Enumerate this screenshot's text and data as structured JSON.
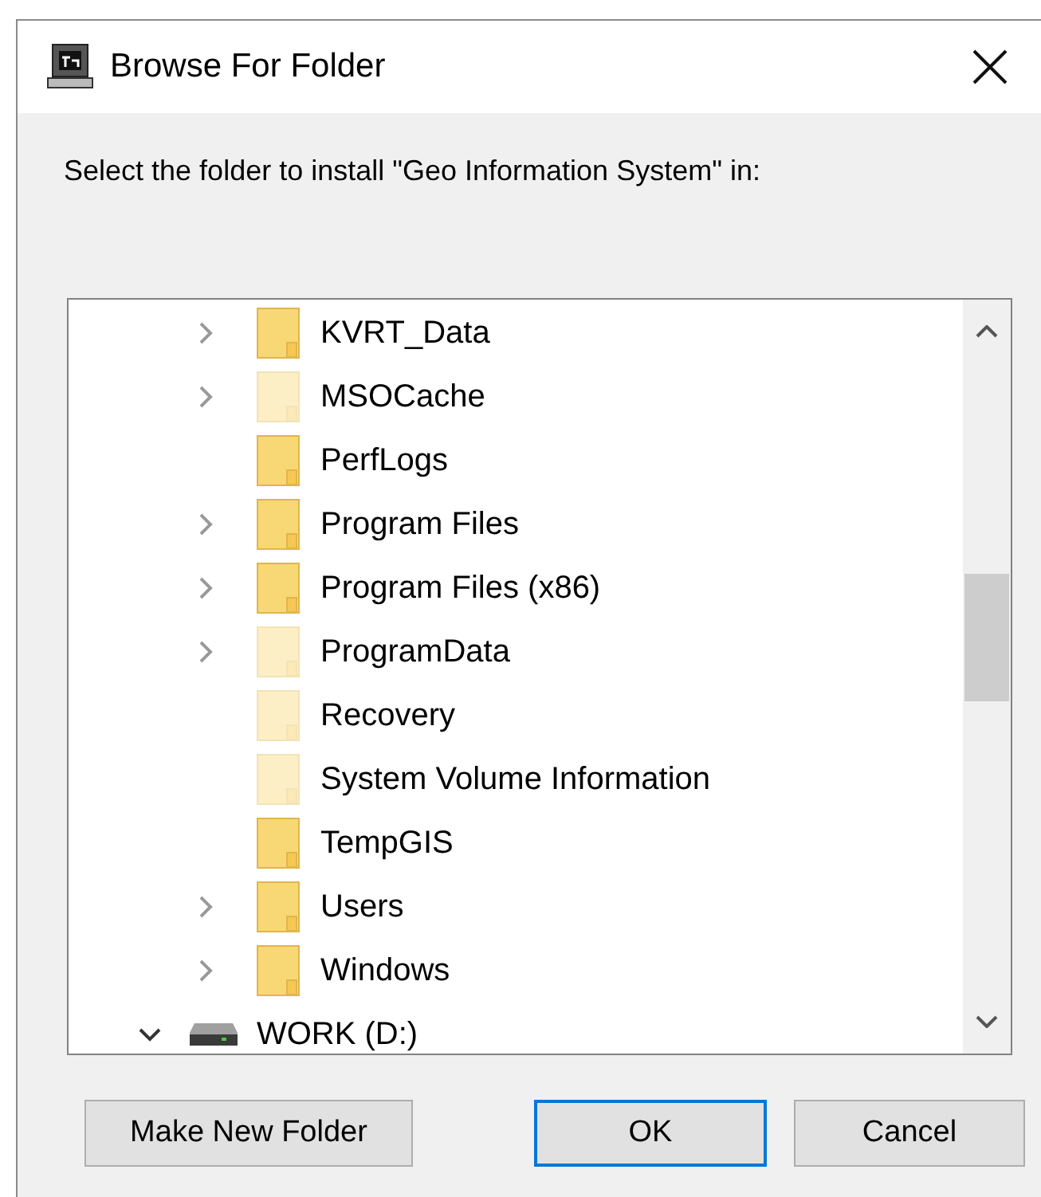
{
  "window": {
    "title": "Browse For Folder"
  },
  "prompt": "Select the folder to install \"Geo Information System\" in:",
  "tree": {
    "items": [
      {
        "kind": "folder",
        "label": "KVRT_Data",
        "hidden": false,
        "has_children": true,
        "expanded": false
      },
      {
        "kind": "folder",
        "label": "MSOCache",
        "hidden": true,
        "has_children": true,
        "expanded": false
      },
      {
        "kind": "folder",
        "label": "PerfLogs",
        "hidden": false,
        "has_children": false
      },
      {
        "kind": "folder",
        "label": "Program Files",
        "hidden": false,
        "has_children": true,
        "expanded": false
      },
      {
        "kind": "folder",
        "label": "Program Files (x86)",
        "hidden": false,
        "has_children": true,
        "expanded": false
      },
      {
        "kind": "folder",
        "label": "ProgramData",
        "hidden": true,
        "has_children": true,
        "expanded": false
      },
      {
        "kind": "folder",
        "label": "Recovery",
        "hidden": true,
        "has_children": false
      },
      {
        "kind": "folder",
        "label": "System Volume Information",
        "hidden": true,
        "has_children": false
      },
      {
        "kind": "folder",
        "label": "TempGIS",
        "hidden": false,
        "has_children": false
      },
      {
        "kind": "folder",
        "label": "Users",
        "hidden": false,
        "has_children": true,
        "expanded": false
      },
      {
        "kind": "folder",
        "label": "Windows",
        "hidden": false,
        "has_children": true,
        "expanded": false
      },
      {
        "kind": "drive",
        "label": "WORK (D:)",
        "has_children": true,
        "expanded": true
      }
    ]
  },
  "buttons": [
    {
      "label": "Make New Folder",
      "default": false
    },
    {
      "label": "OK",
      "default": true
    },
    {
      "label": "Cancel",
      "default": false
    }
  ]
}
